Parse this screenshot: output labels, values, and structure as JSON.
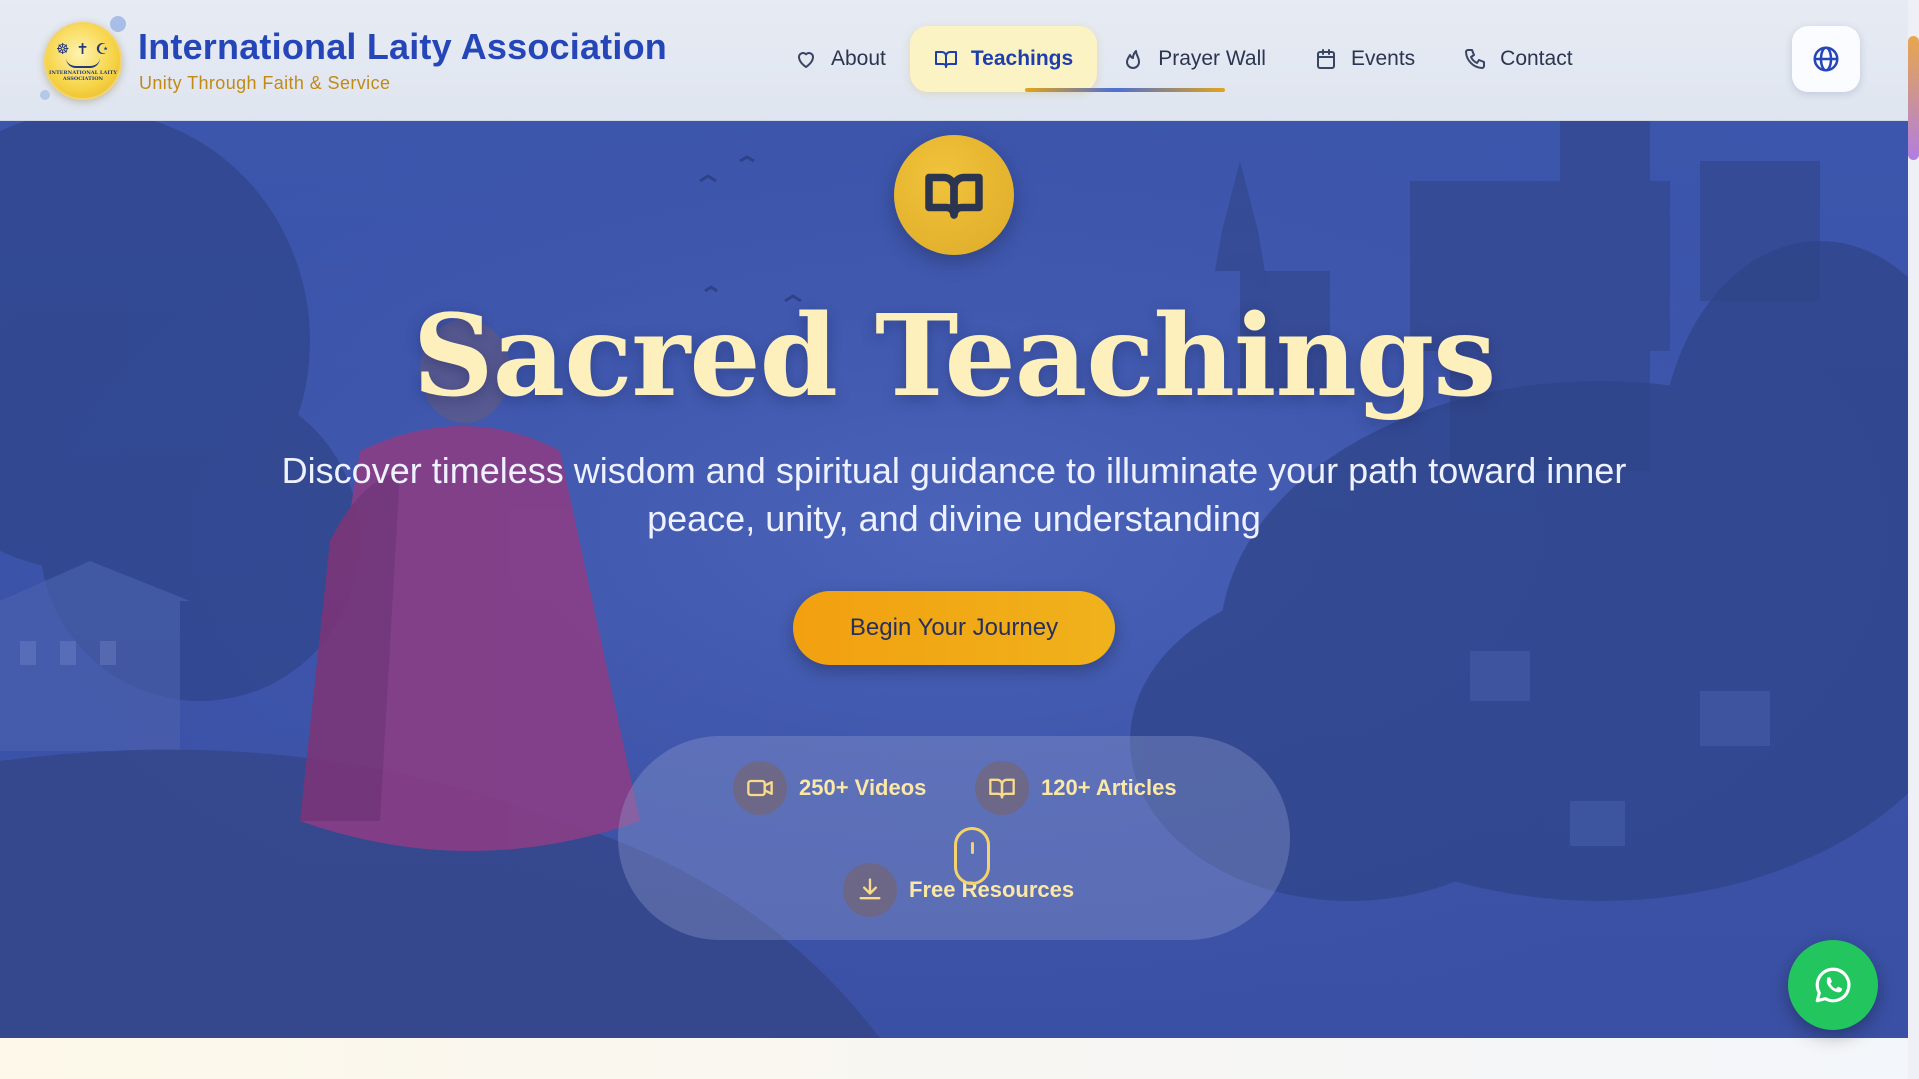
{
  "brand": {
    "title": "International Laity Association",
    "subtitle": "Unity Through Faith & Service",
    "logo_symbols": "☸ ✝ ☪",
    "logo_text": "INTERNATIONAL LAITY ASSOCIATION"
  },
  "nav": {
    "items": [
      {
        "label": "About",
        "icon": "heart-icon"
      },
      {
        "label": "Teachings",
        "icon": "book-open-icon",
        "active": true
      },
      {
        "label": "Prayer Wall",
        "icon": "flame-icon"
      },
      {
        "label": "Events",
        "icon": "calendar-icon"
      },
      {
        "label": "Contact",
        "icon": "phone-icon"
      }
    ],
    "language_icon": "globe-icon"
  },
  "hero": {
    "icon": "book-open-icon",
    "title": "Sacred Teachings",
    "description": "Discover timeless wisdom and spiritual guidance to illuminate your path toward inner peace, unity, and divine understanding",
    "cta_label": "Begin Your Journey"
  },
  "stats": [
    {
      "label": "250+ Videos",
      "icon": "video-icon"
    },
    {
      "label": "120+ Articles",
      "icon": "book-open-icon"
    },
    {
      "label": "Free Resources",
      "icon": "download-icon"
    }
  ],
  "floating": {
    "whatsapp_icon": "whatsapp-icon"
  },
  "colors": {
    "brand_blue": "#2446b8",
    "accent_gold": "#f2a00f",
    "hero_overlay": "#3b53aa",
    "title_cream": "#fdf0bd",
    "whatsapp_green": "#23c55e"
  }
}
